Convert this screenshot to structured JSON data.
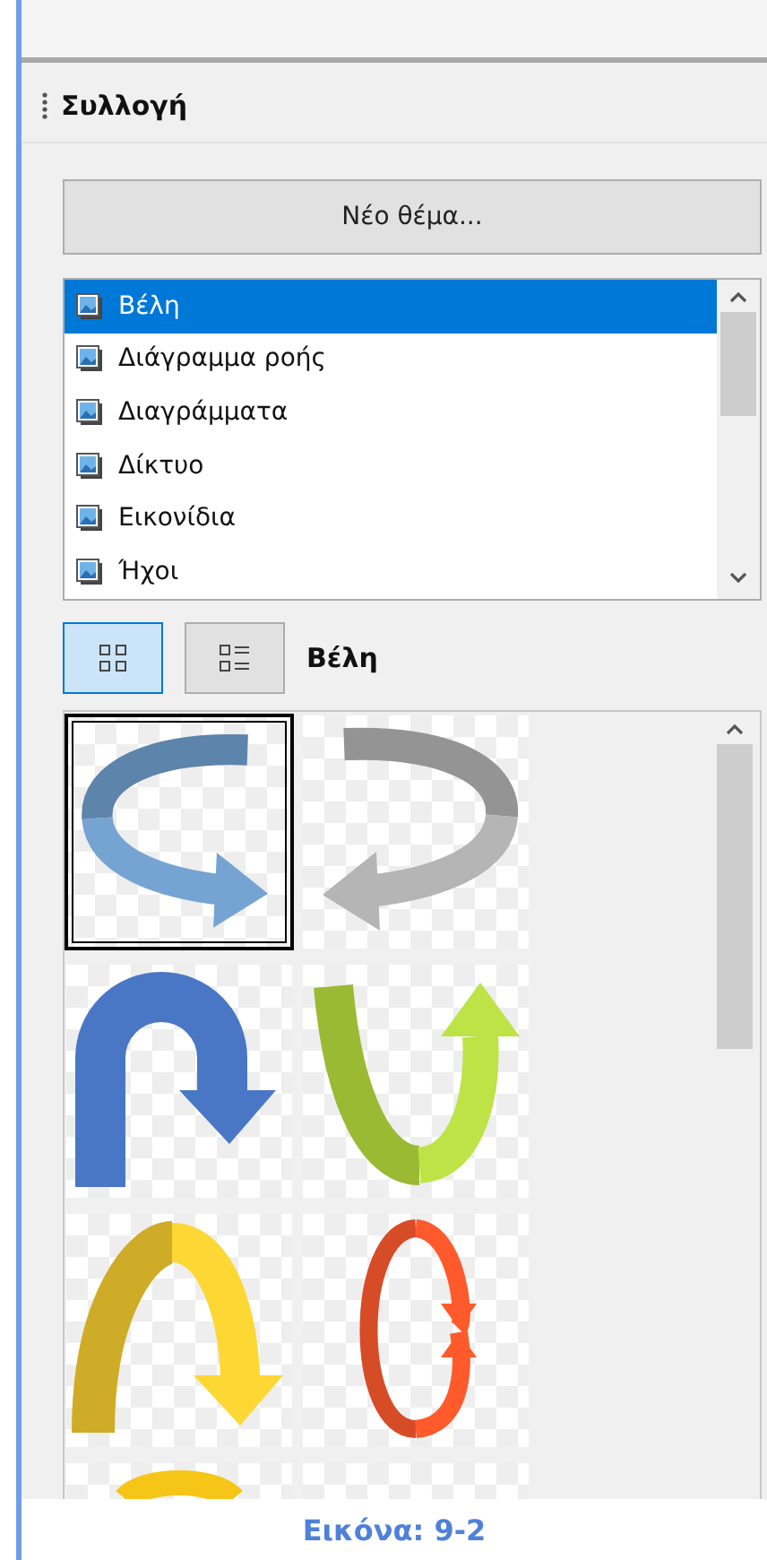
{
  "panel": {
    "title": "Συλλογή"
  },
  "new_theme_button": {
    "label": "Νέο θέμα..."
  },
  "themes": [
    {
      "label": "Βέλη",
      "selected": true
    },
    {
      "label": "Διάγραμμα ροής",
      "selected": false
    },
    {
      "label": "Διαγράμματα",
      "selected": false
    },
    {
      "label": "Δίκτυο",
      "selected": false
    },
    {
      "label": "Εικονίδια",
      "selected": false
    },
    {
      "label": "Ήχοι",
      "selected": false
    }
  ],
  "view_buttons": [
    {
      "kind": "icons",
      "selected": true
    },
    {
      "kind": "details",
      "selected": false
    }
  ],
  "gallery": {
    "title": "Βέλη",
    "items": [
      {
        "kind": "ring-right",
        "selected": true
      },
      {
        "kind": "ring-left",
        "selected": false
      },
      {
        "kind": "u-turn",
        "selected": false
      },
      {
        "kind": "ribbon-up",
        "selected": false
      },
      {
        "kind": "arch-down",
        "selected": false
      },
      {
        "kind": "loop",
        "selected": false
      },
      {
        "kind": "dome",
        "selected": false
      },
      {
        "kind": "blank",
        "selected": false
      }
    ]
  },
  "caption": "Εικόνα: 9-2"
}
